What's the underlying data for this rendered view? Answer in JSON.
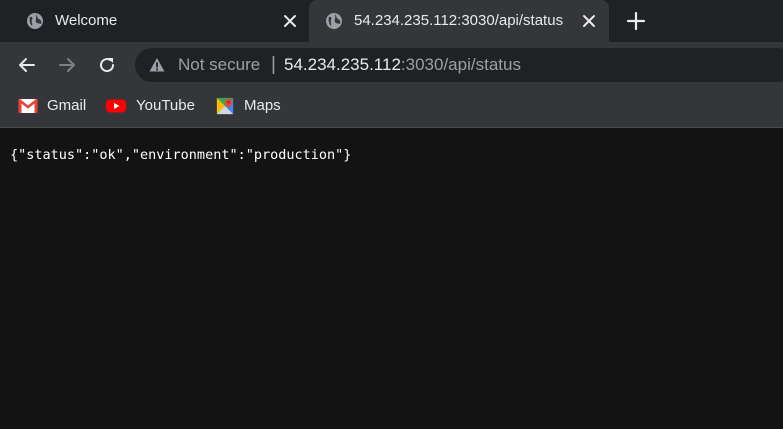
{
  "browser": {
    "tabs": [
      {
        "title": "Welcome",
        "favicon": "globe-icon",
        "active": false
      },
      {
        "title": "54.234.235.112:3030/api/status",
        "favicon": "globe-icon",
        "active": true
      }
    ],
    "new_tab_icon": "plus-icon"
  },
  "toolbar": {
    "back_icon": "back-arrow-icon",
    "forward_icon": "forward-arrow-icon",
    "reload_icon": "reload-icon",
    "security_label": "Not secure",
    "separator": "|",
    "url_host": "54.234.235.112",
    "url_rest": ":3030/api/status"
  },
  "bookmarks": [
    {
      "label": "Gmail",
      "icon": "gmail-icon"
    },
    {
      "label": "YouTube",
      "icon": "youtube-icon"
    },
    {
      "label": "Maps",
      "icon": "maps-icon"
    }
  ],
  "page": {
    "body_text": "{\"status\":\"ok\",\"environment\":\"production\"}"
  },
  "colors": {
    "tabstrip": "#202124",
    "toolbar": "#35363a",
    "omnibox": "#202124",
    "page_background": "#131313",
    "text": "#e8eaed",
    "muted": "#9aa0a6"
  }
}
